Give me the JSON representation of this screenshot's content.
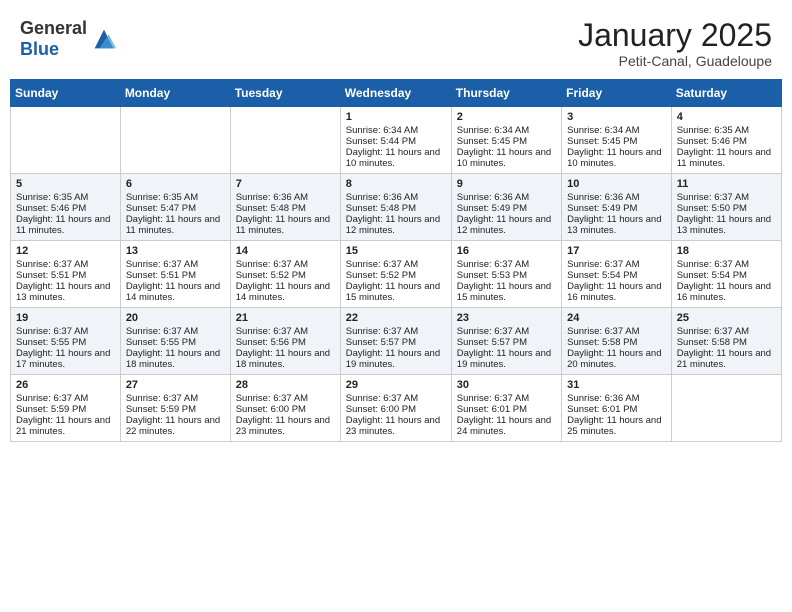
{
  "header": {
    "logo_general": "General",
    "logo_blue": "Blue",
    "month": "January 2025",
    "location": "Petit-Canal, Guadeloupe"
  },
  "weekdays": [
    "Sunday",
    "Monday",
    "Tuesday",
    "Wednesday",
    "Thursday",
    "Friday",
    "Saturday"
  ],
  "weeks": [
    [
      {
        "day": "",
        "sunrise": "",
        "sunset": "",
        "daylight": ""
      },
      {
        "day": "",
        "sunrise": "",
        "sunset": "",
        "daylight": ""
      },
      {
        "day": "",
        "sunrise": "",
        "sunset": "",
        "daylight": ""
      },
      {
        "day": "1",
        "sunrise": "Sunrise: 6:34 AM",
        "sunset": "Sunset: 5:44 PM",
        "daylight": "Daylight: 11 hours and 10 minutes."
      },
      {
        "day": "2",
        "sunrise": "Sunrise: 6:34 AM",
        "sunset": "Sunset: 5:45 PM",
        "daylight": "Daylight: 11 hours and 10 minutes."
      },
      {
        "day": "3",
        "sunrise": "Sunrise: 6:34 AM",
        "sunset": "Sunset: 5:45 PM",
        "daylight": "Daylight: 11 hours and 10 minutes."
      },
      {
        "day": "4",
        "sunrise": "Sunrise: 6:35 AM",
        "sunset": "Sunset: 5:46 PM",
        "daylight": "Daylight: 11 hours and 11 minutes."
      }
    ],
    [
      {
        "day": "5",
        "sunrise": "Sunrise: 6:35 AM",
        "sunset": "Sunset: 5:46 PM",
        "daylight": "Daylight: 11 hours and 11 minutes."
      },
      {
        "day": "6",
        "sunrise": "Sunrise: 6:35 AM",
        "sunset": "Sunset: 5:47 PM",
        "daylight": "Daylight: 11 hours and 11 minutes."
      },
      {
        "day": "7",
        "sunrise": "Sunrise: 6:36 AM",
        "sunset": "Sunset: 5:48 PM",
        "daylight": "Daylight: 11 hours and 11 minutes."
      },
      {
        "day": "8",
        "sunrise": "Sunrise: 6:36 AM",
        "sunset": "Sunset: 5:48 PM",
        "daylight": "Daylight: 11 hours and 12 minutes."
      },
      {
        "day": "9",
        "sunrise": "Sunrise: 6:36 AM",
        "sunset": "Sunset: 5:49 PM",
        "daylight": "Daylight: 11 hours and 12 minutes."
      },
      {
        "day": "10",
        "sunrise": "Sunrise: 6:36 AM",
        "sunset": "Sunset: 5:49 PM",
        "daylight": "Daylight: 11 hours and 13 minutes."
      },
      {
        "day": "11",
        "sunrise": "Sunrise: 6:37 AM",
        "sunset": "Sunset: 5:50 PM",
        "daylight": "Daylight: 11 hours and 13 minutes."
      }
    ],
    [
      {
        "day": "12",
        "sunrise": "Sunrise: 6:37 AM",
        "sunset": "Sunset: 5:51 PM",
        "daylight": "Daylight: 11 hours and 13 minutes."
      },
      {
        "day": "13",
        "sunrise": "Sunrise: 6:37 AM",
        "sunset": "Sunset: 5:51 PM",
        "daylight": "Daylight: 11 hours and 14 minutes."
      },
      {
        "day": "14",
        "sunrise": "Sunrise: 6:37 AM",
        "sunset": "Sunset: 5:52 PM",
        "daylight": "Daylight: 11 hours and 14 minutes."
      },
      {
        "day": "15",
        "sunrise": "Sunrise: 6:37 AM",
        "sunset": "Sunset: 5:52 PM",
        "daylight": "Daylight: 11 hours and 15 minutes."
      },
      {
        "day": "16",
        "sunrise": "Sunrise: 6:37 AM",
        "sunset": "Sunset: 5:53 PM",
        "daylight": "Daylight: 11 hours and 15 minutes."
      },
      {
        "day": "17",
        "sunrise": "Sunrise: 6:37 AM",
        "sunset": "Sunset: 5:54 PM",
        "daylight": "Daylight: 11 hours and 16 minutes."
      },
      {
        "day": "18",
        "sunrise": "Sunrise: 6:37 AM",
        "sunset": "Sunset: 5:54 PM",
        "daylight": "Daylight: 11 hours and 16 minutes."
      }
    ],
    [
      {
        "day": "19",
        "sunrise": "Sunrise: 6:37 AM",
        "sunset": "Sunset: 5:55 PM",
        "daylight": "Daylight: 11 hours and 17 minutes."
      },
      {
        "day": "20",
        "sunrise": "Sunrise: 6:37 AM",
        "sunset": "Sunset: 5:55 PM",
        "daylight": "Daylight: 11 hours and 18 minutes."
      },
      {
        "day": "21",
        "sunrise": "Sunrise: 6:37 AM",
        "sunset": "Sunset: 5:56 PM",
        "daylight": "Daylight: 11 hours and 18 minutes."
      },
      {
        "day": "22",
        "sunrise": "Sunrise: 6:37 AM",
        "sunset": "Sunset: 5:57 PM",
        "daylight": "Daylight: 11 hours and 19 minutes."
      },
      {
        "day": "23",
        "sunrise": "Sunrise: 6:37 AM",
        "sunset": "Sunset: 5:57 PM",
        "daylight": "Daylight: 11 hours and 19 minutes."
      },
      {
        "day": "24",
        "sunrise": "Sunrise: 6:37 AM",
        "sunset": "Sunset: 5:58 PM",
        "daylight": "Daylight: 11 hours and 20 minutes."
      },
      {
        "day": "25",
        "sunrise": "Sunrise: 6:37 AM",
        "sunset": "Sunset: 5:58 PM",
        "daylight": "Daylight: 11 hours and 21 minutes."
      }
    ],
    [
      {
        "day": "26",
        "sunrise": "Sunrise: 6:37 AM",
        "sunset": "Sunset: 5:59 PM",
        "daylight": "Daylight: 11 hours and 21 minutes."
      },
      {
        "day": "27",
        "sunrise": "Sunrise: 6:37 AM",
        "sunset": "Sunset: 5:59 PM",
        "daylight": "Daylight: 11 hours and 22 minutes."
      },
      {
        "day": "28",
        "sunrise": "Sunrise: 6:37 AM",
        "sunset": "Sunset: 6:00 PM",
        "daylight": "Daylight: 11 hours and 23 minutes."
      },
      {
        "day": "29",
        "sunrise": "Sunrise: 6:37 AM",
        "sunset": "Sunset: 6:00 PM",
        "daylight": "Daylight: 11 hours and 23 minutes."
      },
      {
        "day": "30",
        "sunrise": "Sunrise: 6:37 AM",
        "sunset": "Sunset: 6:01 PM",
        "daylight": "Daylight: 11 hours and 24 minutes."
      },
      {
        "day": "31",
        "sunrise": "Sunrise: 6:36 AM",
        "sunset": "Sunset: 6:01 PM",
        "daylight": "Daylight: 11 hours and 25 minutes."
      },
      {
        "day": "",
        "sunrise": "",
        "sunset": "",
        "daylight": ""
      }
    ]
  ]
}
